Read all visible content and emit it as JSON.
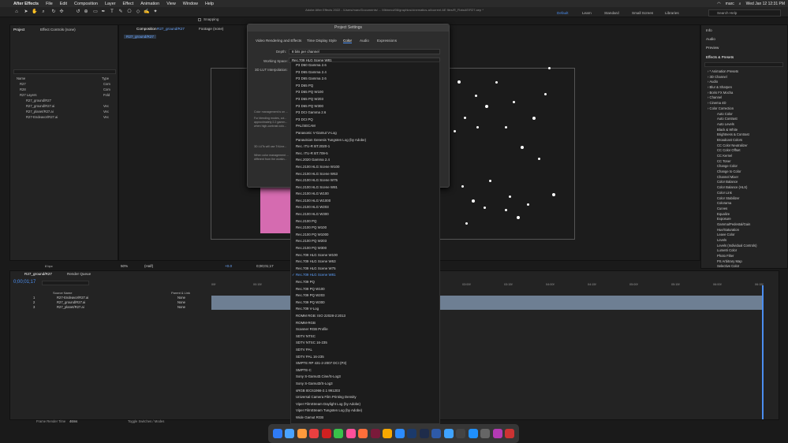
{
  "menubar": {
    "app": "After Effects",
    "items": [
      "File",
      "Edit",
      "Composition",
      "Layer",
      "Effect",
      "Animation",
      "View",
      "Window",
      "Help"
    ],
    "user": "marc",
    "clock": "Wed Jan 12  12:31 PM"
  },
  "toolbar": {
    "snapping": "Snapping",
    "doc_title": "Adobe After Effects 2022 - /Users/marc/Documents/ ... Mbinmol/08/graphics/cinematics-al/current AE files/R_FlatsAE/R27.aep *",
    "workspaces": [
      "Default",
      "Learn",
      "Standard",
      "Small Screen",
      "Libraries"
    ],
    "help_search": "Search Help"
  },
  "project": {
    "tab": "Project",
    "effect_controls": "Effect Controls (none)",
    "col_name": "Name",
    "col_type": "Type",
    "items": [
      {
        "name": "R27",
        "type": "Com"
      },
      {
        "name": "R28",
        "type": "Com"
      },
      {
        "name": "R27 Layers",
        "type": "Fold"
      },
      {
        "name": "R27_ground/R27",
        "type": ""
      },
      {
        "name": "R27_ground/R27.ai",
        "type": "Vec"
      },
      {
        "name": "R27_planet/R27.ai",
        "type": "Vec"
      },
      {
        "name": "R27-Endeavor/R27.ai",
        "type": "Vec"
      }
    ],
    "bpc": "8 bpc"
  },
  "comp": {
    "tab": "Composition",
    "tab_name": "R27_ground/R27",
    "footage": "Footage (none)",
    "crumb": "R27_ground/R27",
    "zoom": "50%",
    "res": "(Half)",
    "timecode": "0;00;01;17",
    "val": "+0.0"
  },
  "dialog": {
    "title": "Project Settings",
    "tabs": [
      "Video Rendering and Effects",
      "Time Display Style",
      "Color",
      "Audio",
      "Expressions"
    ],
    "depth_label": "Depth:",
    "depth_value": "8 bits per channel",
    "ws_label": "Working Space:",
    "ws_value": "Rec.709 HLG Scene W81",
    "lut_label": "3D LUT Interpolation:",
    "note1": "Color management is on ...",
    "note2": "For blending modes, col... approximately 2.2 gamm... when high-contrast colo...",
    "note3": "3D LUTs will use TriLine...",
    "note4": "When color management ... different from the workin..."
  },
  "dropdown": {
    "selected_index": 31,
    "items": [
      "P3 D60 Gamma 2.6",
      "P3 D65 Gamma 2.4",
      "P3 D65 Gamma 2.6",
      "P3 D65 PQ",
      "P3 D65 PQ W100",
      "P3 D65 PQ W203",
      "P3 D65 PQ W300",
      "P3 DCI Gamma 2.6",
      "P3 DCI PQ",
      "PAL/SECAM",
      "Panasonic V-Gamut V-Log",
      "Panavision Genesis Tungsten Log (by Adobe)",
      "Rec. ITU-R BT.2020-1",
      "Rec. ITU-R BT.709-5",
      "Rec.2020 Gamma 2.4",
      "Rec.2100 HLG Scene W100",
      "Rec.2100 HLG Scene W63",
      "Rec.2100 HLG Scene W75",
      "Rec.2100 HLG Scene W81",
      "Rec.2100 HLG W100",
      "Rec.2100 HLG W1000",
      "Rec.2100 HLG W203",
      "Rec.2100 HLG W300",
      "Rec.2100 PQ",
      "Rec.2100 PQ W100",
      "Rec.2100 PQ W1000",
      "Rec.2100 PQ W203",
      "Rec.2100 PQ W300",
      "Rec.709 HLG Scene W100",
      "Rec.709 HLG Scene W63",
      "Rec.709 HLG Scene W75",
      "Rec.709 HLG Scene W81",
      "Rec.709 PQ",
      "Rec.709 PQ W100",
      "Rec.709 PQ W203",
      "Rec.709 PQ W300",
      "Rec.709 V-Log",
      "ROMM RGB: ISO 22028-2:2013",
      "ROMM-RGB",
      "Scanner RGB Profile",
      "SDTV NTSC",
      "SDTV NTSC 16-235",
      "SDTV PAL",
      "SDTV PAL 16-235",
      "SMPTE RP 431-2-2007 DCI (P3)",
      "SMPTE-C",
      "Sony S-Gamut3.Cine/S-Log3",
      "Sony S-Gamut3/S-Log3",
      "sRGB IEC61966-2.1 991203",
      "Universal Camera Film Printing Density",
      "Viper FilmStream Daylight Log (by Adobe)",
      "Viper FilmStream Tungsten Log (by Adobe)",
      "Wide Gamut RGB"
    ]
  },
  "rightpanel": {
    "info": "Info",
    "audio": "Audio",
    "preview": "Preview",
    "effects": "Effects & Presets",
    "groups": [
      "* Animation Presets",
      "3D Channel",
      "Audio",
      "Blur & Sharpen",
      "Boris FX Mocha",
      "Channel",
      "Cinema 4D",
      "Color Correction"
    ],
    "cc_items": [
      "Auto Color",
      "Auto Contrast",
      "Auto Levels",
      "Black & White",
      "Brightness & Contrast",
      "Broadcast Colors",
      "CC Color Neutralizer",
      "CC Color Offset",
      "CC Kernel",
      "CC Toner",
      "Change Color",
      "Change to Color",
      "Channel Mixer",
      "Color Balance",
      "Color Balance (HLS)",
      "Color Link",
      "Color Stabilizer",
      "Colorama",
      "Curves",
      "Equalize",
      "Exposure",
      "Gamma/Pedestal/Gain",
      "Hue/Saturation",
      "Leave Color",
      "Levels",
      "Levels (Individual Controls)",
      "Lumetri Color",
      "Photo Filter",
      "PS Arbitrary Map",
      "Selective Color"
    ]
  },
  "timeline": {
    "tab": "R27_ground/R27",
    "render_queue": "Render Queue",
    "timecode": "0;00;01;17",
    "col_source": "Source Name",
    "col_parent": "Parent & Link",
    "layers": [
      {
        "num": "1",
        "name": "R27-Endeavor/R27.ai",
        "parent": "None"
      },
      {
        "num": "2",
        "name": "R27_ground/R27.ai",
        "parent": "None"
      },
      {
        "num": "3",
        "name": "R27_planet/R27.ai",
        "parent": "None"
      }
    ],
    "ticks": [
      "00f",
      "00:15f",
      "01:00f",
      "01:15f",
      "02:00f",
      "02:15f",
      "03:00f",
      "03:15f",
      "04:00f",
      "04:15f",
      "05:00f",
      "05:15f",
      "06:00f",
      "06:15f"
    ],
    "frame_render": "Frame Render Time",
    "frame_render_val": "46ms",
    "toggle": "Toggle Switches / Modes"
  },
  "dock": {
    "colors": [
      "#2f7bf5",
      "#4aa3ff",
      "#ff9a3c",
      "#e94040",
      "#d02020",
      "#38c24a",
      "#ff4f9a",
      "#ff6e3a",
      "#7a1a3a",
      "#f7a800",
      "#2c8cff",
      "#1b3a6b",
      "#1e2c4a",
      "#2e5aa8",
      "#3fa3ff",
      "#444",
      "#1f90ff",
      "#666",
      "#b43ab4",
      "#cc3333"
    ]
  }
}
